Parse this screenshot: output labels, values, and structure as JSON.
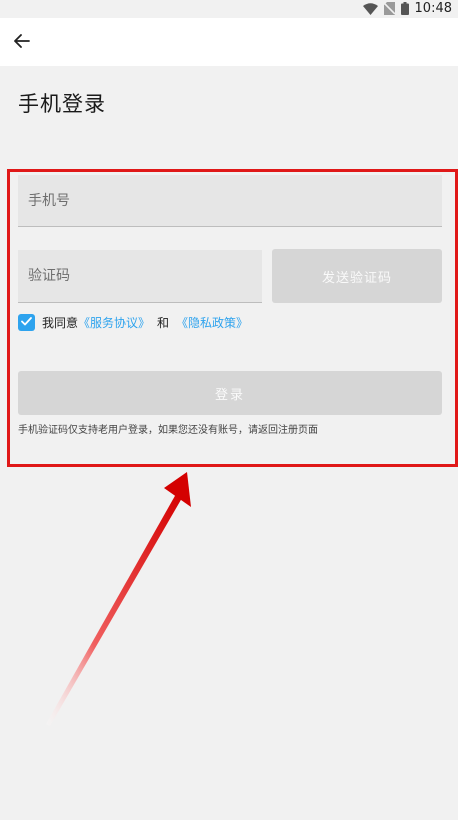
{
  "status_bar": {
    "time": "10:48",
    "icons": [
      "wifi-icon",
      "no-sim-icon",
      "battery-icon"
    ]
  },
  "header": {
    "back_icon": "arrow-left-icon"
  },
  "page": {
    "title": "手机登录"
  },
  "form": {
    "phone_placeholder": "手机号",
    "code_placeholder": "验证码",
    "send_code_label": "发送验证码",
    "agree": {
      "checked": true,
      "prefix": "我同意",
      "terms_link": "《服务协议》",
      "and": "和",
      "privacy_link": "《隐私政策》"
    },
    "login_label": "登录",
    "hint": "手机验证码仅支持老用户登录，如果您还没有账号，请返回注册页面"
  },
  "colors": {
    "accent": "#2ea3ee",
    "disabled_button": "#d6d6d6",
    "annotation": "#e01818",
    "background": "#f1f1f1"
  }
}
